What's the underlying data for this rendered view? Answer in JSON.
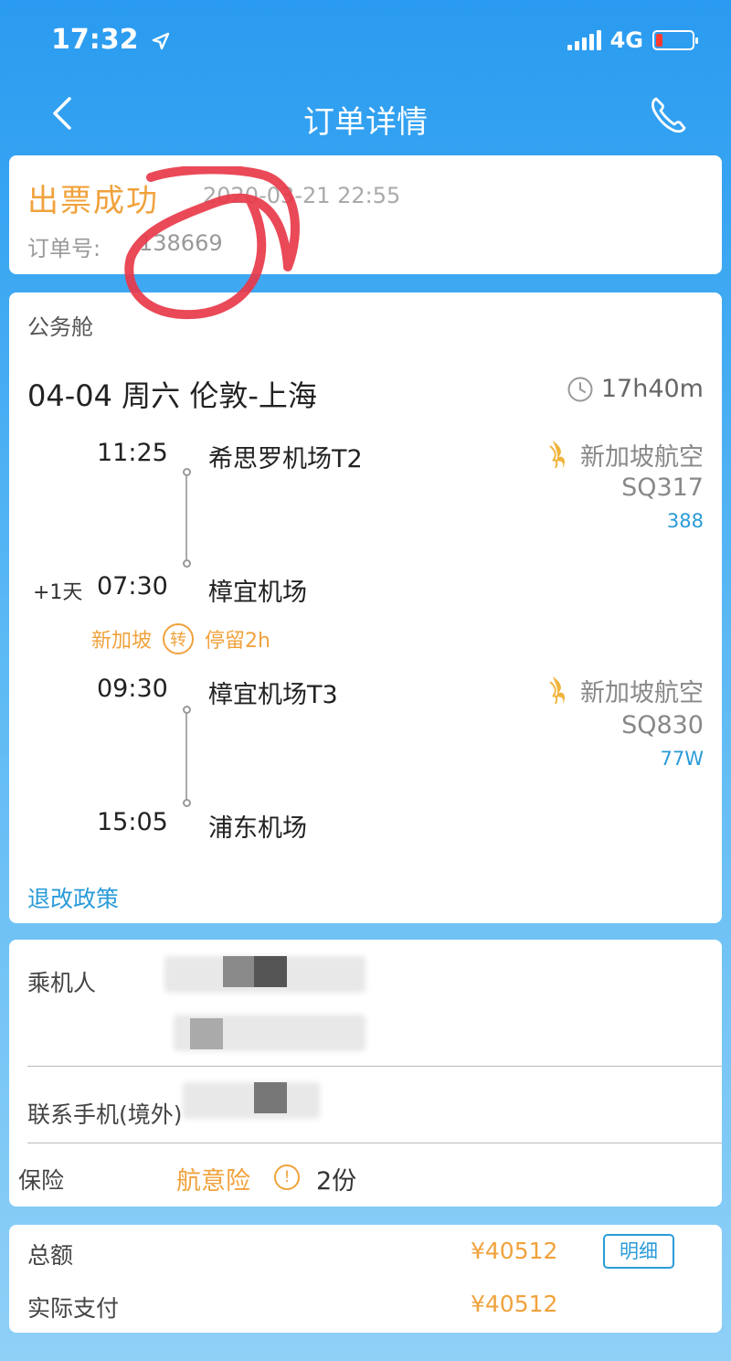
{
  "status_bar": {
    "time": "17:32",
    "network": "4G"
  },
  "nav": {
    "title": "订单详情"
  },
  "order_status": {
    "title": "出票成功",
    "date": "2020-03-21 22:55",
    "order_label": "订单号:",
    "order_number": "138669"
  },
  "flight": {
    "cabin": "公务舱",
    "route": "04-04 周六 伦敦-上海",
    "duration": "17h40m",
    "segments": [
      {
        "depart_time": "11:25",
        "depart_airport": "希思罗机场T2",
        "arrive_time": "07:30",
        "arrive_airport": "樟宜机场",
        "arrive_day_offset": "+1天",
        "airline": "新加坡航空",
        "flight_no": "SQ317",
        "aircraft": "388"
      },
      {
        "depart_time": "09:30",
        "depart_airport": "樟宜机场T3",
        "arrive_time": "15:05",
        "arrive_airport": "浦东机场",
        "airline": "新加坡航空",
        "flight_no": "SQ830",
        "aircraft": "77W"
      }
    ],
    "transfer": {
      "city": "新加坡",
      "badge": "转",
      "stay": "停留2h"
    },
    "policy_link": "退改政策"
  },
  "passenger": {
    "passenger_label": "乘机人",
    "phone_label": "联系手机(境外)",
    "insurance_label": "保险",
    "insurance_name": "航意险",
    "insurance_info": "!",
    "insurance_count": "2份"
  },
  "payment": {
    "total_label": "总额",
    "total_amount": "¥40512",
    "detail_button": "明细",
    "paid_label": "实际支付",
    "paid_amount": "¥40512"
  },
  "colors": {
    "header_blue": "#2a9bf0",
    "accent_orange": "#f0a23c",
    "link_blue": "#2a9bd8",
    "scribble_red": "#e8394a"
  }
}
